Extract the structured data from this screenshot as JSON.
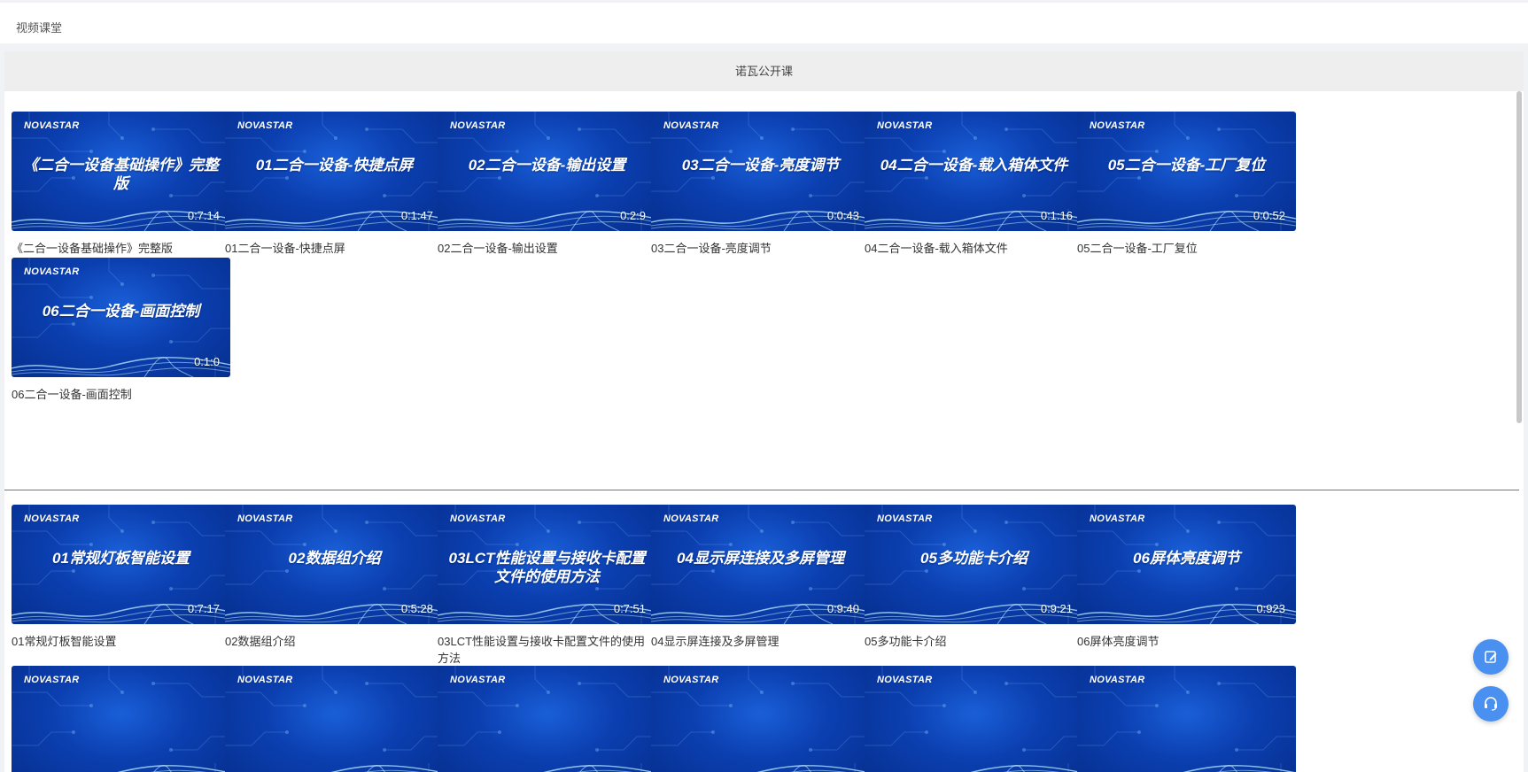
{
  "breadcrumb": "视频课堂",
  "panel_title": "诺瓦公开课",
  "logo_text": "NOVASTAR",
  "section1": [
    {
      "thumb_title": "《二合一设备基础操作》完整版",
      "duration": "0:7:14",
      "caption": "《二合一设备基础操作》完整版"
    },
    {
      "thumb_title": "01二合一设备-快捷点屏",
      "duration": "0:1:47",
      "caption": "01二合一设备-快捷点屏"
    },
    {
      "thumb_title": "02二合一设备-输出设置",
      "duration": "0:2:9",
      "caption": "02二合一设备-输出设置"
    },
    {
      "thumb_title": "03二合一设备-亮度调节",
      "duration": "0:0:43",
      "caption": "03二合一设备-亮度调节"
    },
    {
      "thumb_title": "04二合一设备-载入箱体文件",
      "duration": "0:1:16",
      "caption": "04二合一设备-载入箱体文件"
    },
    {
      "thumb_title": "05二合一设备-工厂复位",
      "duration": "0:0:52",
      "caption": "05二合一设备-工厂复位"
    },
    {
      "thumb_title": "06二合一设备-画面控制",
      "duration": "0:1:0",
      "caption": "06二合一设备-画面控制"
    }
  ],
  "section2": [
    {
      "thumb_title": "01常规灯板智能设置",
      "duration": "0:7:17",
      "caption": "01常规灯板智能设置"
    },
    {
      "thumb_title": "02数据组介绍",
      "duration": "0:5:28",
      "caption": "02数据组介绍"
    },
    {
      "thumb_title": "03LCT性能设置与接收卡配置文件的使用方法",
      "duration": "0:7:51",
      "caption": "03LCT性能设置与接收卡配置文件的使用方法"
    },
    {
      "thumb_title": "04显示屏连接及多屏管理",
      "duration": "0:9:40",
      "caption": "04显示屏连接及多屏管理"
    },
    {
      "thumb_title": "05多功能卡介绍",
      "duration": "0:9:21",
      "caption": "05多功能卡介绍"
    },
    {
      "thumb_title": "06屏体亮度调节",
      "duration": "0:923",
      "caption": "06屏体亮度调节"
    }
  ],
  "section3_count": 6,
  "colors": {
    "accent": "#4a90f0",
    "thumb_blue": "#0b3fb0",
    "divider": "#4a8f6c"
  },
  "icons": {
    "fab_top": "edit-icon",
    "fab_bottom": "headset-icon"
  }
}
